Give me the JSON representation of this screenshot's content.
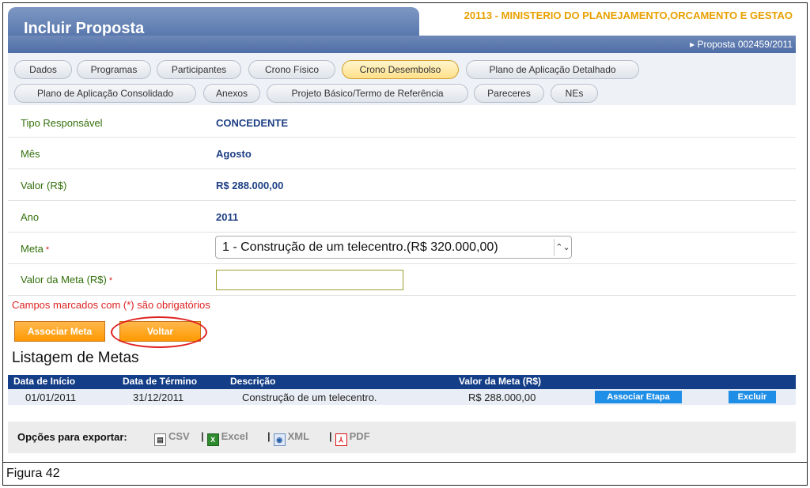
{
  "header": {
    "title": "Incluir Proposta",
    "organization": "20113 - MINISTERIO DO PLANEJAMENTO,ORCAMENTO E GESTAO",
    "proposal": "Proposta 002459/2011"
  },
  "tabs": [
    {
      "label": "Dados",
      "active": false
    },
    {
      "label": "Programas",
      "active": false
    },
    {
      "label": "Participantes",
      "active": false
    },
    {
      "label": "Crono Físico",
      "active": false
    },
    {
      "label": "Crono Desembolso",
      "active": true
    },
    {
      "label": "Plano de Aplicação Detalhado",
      "active": false
    },
    {
      "label": "Plano de Aplicação Consolidado",
      "active": false
    },
    {
      "label": "Anexos",
      "active": false
    },
    {
      "label": "Projeto Básico/Termo de Referência",
      "active": false
    },
    {
      "label": "Pareceres",
      "active": false
    },
    {
      "label": "NEs",
      "active": false
    }
  ],
  "form": {
    "tipo_label": "Tipo Responsável",
    "tipo_value": "CONCEDENTE",
    "mes_label": "Mês",
    "mes_value": "Agosto",
    "valor_label": "Valor (R$)",
    "valor_value": "R$ 288.000,00",
    "ano_label": "Ano",
    "ano_value": "2011",
    "meta_label": "Meta",
    "meta_selected": "1 - Construção de um telecentro.(R$ 320.000,00)",
    "valor_meta_label": "Valor da Meta (R$)",
    "valor_meta_value": "",
    "required_mark": "*",
    "required_msg": "Campos marcados com (*) são obrigatórios"
  },
  "buttons": {
    "associar": "Associar Meta",
    "voltar": "Voltar"
  },
  "list": {
    "title": "Listagem de Metas",
    "columns": [
      "Data de Início",
      "Data de Término",
      "Descrição",
      "Valor da Meta (R$)"
    ],
    "rows": [
      {
        "inicio": "01/01/2011",
        "termino": "31/12/2011",
        "descricao": "Construção de um telecentro.",
        "valor": "R$ 288.000,00",
        "btn_etapa": "Associar Etapa",
        "btn_excluir": "Excluir"
      }
    ]
  },
  "export": {
    "label": "Opções para exportar:",
    "csv": "CSV",
    "excel": "Excel",
    "xml": "XML",
    "pdf": "PDF",
    "separator": "|"
  },
  "caption": "Figura 42",
  "colors": {
    "header": "#5a78ad",
    "accent": "#ff9900",
    "label_green": "#33700c",
    "value_blue": "#1e3f84",
    "table_header": "#143e87"
  }
}
